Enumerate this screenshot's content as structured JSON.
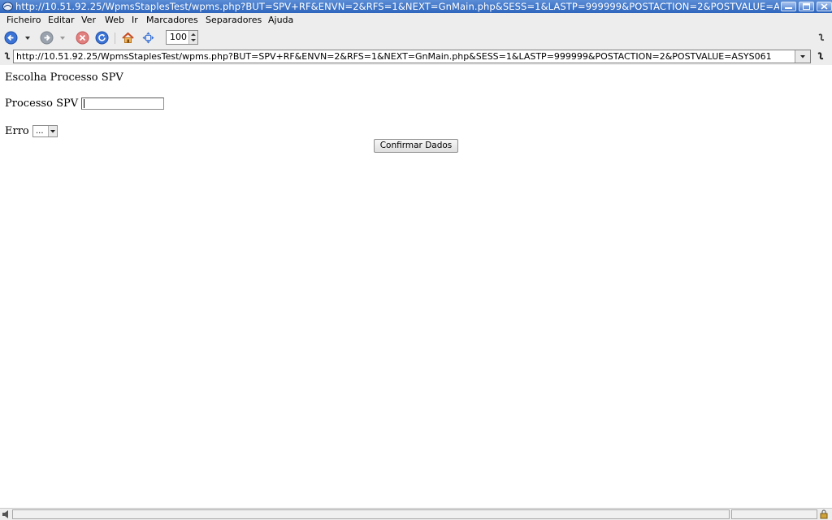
{
  "window": {
    "title": "http://10.51.92.25/WpmsStaplesTest/wpms.php?BUT=SPV+RF&ENVN=2&RFS=1&NEXT=GnMain.php&SESS=1&LASTP=999999&POSTACTION=2&POSTVALUE=ASYS061"
  },
  "menu": {
    "items": [
      "Ficheiro",
      "Editar",
      "Ver",
      "Web",
      "Ir",
      "Marcadores",
      "Separadores",
      "Ajuda"
    ]
  },
  "toolbar": {
    "zoom": "100",
    "icons": [
      "back-icon",
      "history-dropdown-icon",
      "forward-icon",
      "stop-icon",
      "reload-icon",
      "home-icon",
      "fullscreen-icon"
    ]
  },
  "address": {
    "url": "http://10.51.92.25/WpmsStaplesTest/wpms.php?BUT=SPV+RF&ENVN=2&RFS=1&NEXT=GnMain.php&SESS=1&LASTP=999999&POSTACTION=2&POSTVALUE=ASYS061"
  },
  "page": {
    "heading": "Escolha Processo SPV",
    "processo_label": "Processo SPV",
    "processo_value": "",
    "erro_label": "Erro",
    "erro_selected": "...",
    "confirm_label": "Confirmar Dados"
  },
  "colors": {
    "titlebar": "#3a72c8",
    "chrome": "#ededed",
    "page_bg": "#ffffff"
  }
}
